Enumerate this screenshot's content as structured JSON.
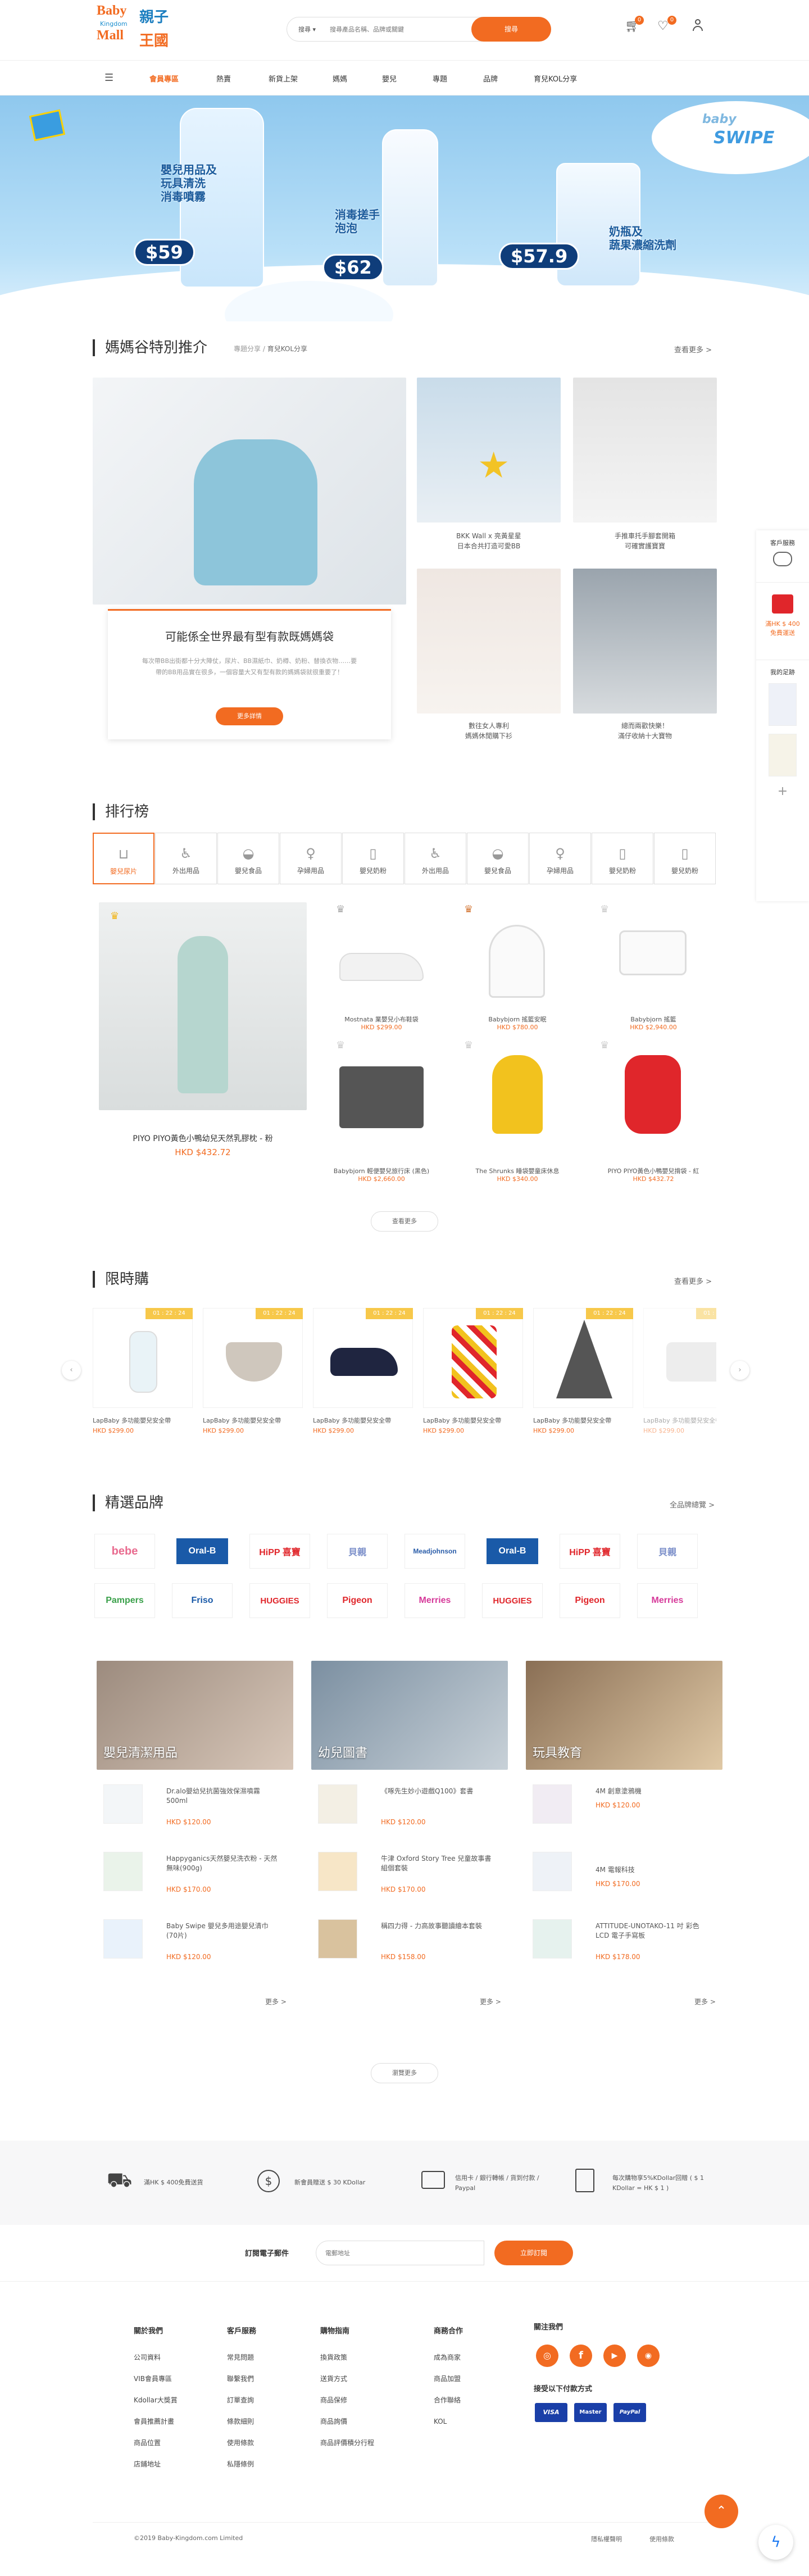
{
  "header": {
    "logo_en_top": "Baby",
    "logo_en_mid": "Kingdom",
    "logo_en_bot": "Mall",
    "logo_zh_top": "親子",
    "logo_zh_bot": "王國",
    "search_category": "搜尋",
    "search_placeholder": "搜尋產品名稱、品牌或關鍵",
    "search_button": "搜尋",
    "cart_count": "0",
    "wish_count": "0"
  },
  "nav": [
    "會員專區",
    "熱賣",
    "新貨上架",
    "媽媽",
    "嬰兒",
    "專題",
    "品牌",
    "育兒KOL分享"
  ],
  "banner": {
    "item1_line1": "嬰兒用品及",
    "item1_line2": "玩具清洗",
    "item1_line3": "消毒噴霧",
    "item1_price": "$59",
    "item2_line1": "消毒搓手",
    "item2_line2": "泡泡",
    "item2_price": "$62",
    "item3_line1": "奶瓶及",
    "item3_line2": "蔬果濃縮洗劑",
    "item3_price": "$57.9",
    "brand_top": "baby",
    "brand_bot": "SWIPE"
  },
  "mom_section": {
    "title": "媽媽谷特別推介",
    "crumb1": "專題分享",
    "crumb2": "育兒KOL分享",
    "more": "查看更多 >",
    "feature_title": "可能係全世界最有型有款既媽媽袋",
    "feature_desc": "每次帶BB出街都十分大陣仗，尿片、BB濕紙巾、奶樽、奶粉、替換衣物……要帶的BB用品實在很多，一個容量大又有型有款的媽媽袋就很重要了！",
    "feature_button": "更多詳情",
    "cards": [
      {
        "title": "BKK Wall x 亮黃星星",
        "subtitle": "日本合共打造可愛BB"
      },
      {
        "title": "手推車托手腳套開箱",
        "subtitle": "可確實護寶寶"
      },
      {
        "title": "數往女人專利",
        "subtitle": "媽媽休閒購下衫"
      },
      {
        "title": "總而兩歡快樂！",
        "subtitle": "滿仔收納十大寶物"
      }
    ]
  },
  "ranking": {
    "title": "排行榜",
    "tabs": [
      "嬰兒尿片",
      "外出用品",
      "嬰兒食品",
      "孕婦用品",
      "嬰兒奶粉",
      "外出用品",
      "嬰兒食品",
      "孕婦用品",
      "嬰兒奶粉",
      "嬰兒奶粉"
    ],
    "top_name": "PIYO PIYO黃色小鴨幼兒天然乳膠枕 - 粉",
    "top_price": "HKD $432.72",
    "items": [
      {
        "name": "Mostnata 業嬰兒小布鞋袋",
        "price": "HKD $299.00"
      },
      {
        "name": "Babybjorn 搖籃安眠",
        "price": "HKD $780.00"
      },
      {
        "name": "Babybjorn 搖籃",
        "price": "HKD $2,940.00"
      },
      {
        "name": "Babybjorn 輕便嬰兒旅行床 (黑色)",
        "price": "HKD $2,660.00"
      },
      {
        "name": "The Shrunks 睡袋嬰童床休息",
        "price": "HKD $340.00"
      },
      {
        "name": "PIYO PIYO黃色小鴨嬰兒揹袋 - 紅",
        "price": "HKD $432.72"
      }
    ],
    "more_button": "查看更多"
  },
  "flash": {
    "title": "限時購",
    "more": "查看更多 >",
    "badge": "01 : 22 : 24",
    "items": [
      {
        "name": "LapBaby 多功能嬰兒安全帶",
        "price": "HKD $299.00"
      },
      {
        "name": "LapBaby 多功能嬰兒安全帶",
        "price": "HKD $299.00"
      },
      {
        "name": "LapBaby 多功能嬰兒安全帶",
        "price": "HKD $299.00"
      },
      {
        "name": "LapBaby 多功能嬰兒安全帶",
        "price": "HKD $299.00"
      },
      {
        "name": "LapBaby 多功能嬰兒安全帶",
        "price": "HKD $299.00"
      },
      {
        "name": "LapBaby 多功能嬰兒安全帶",
        "price": "HKD $299.00"
      }
    ]
  },
  "brands": {
    "title": "精選品牌",
    "more": "全品牌總覽 >",
    "row1": [
      "bebe",
      "Oral-B",
      "HiPP 喜寶",
      "貝親",
      "Meadjohnson",
      "Oral-B",
      "HiPP 喜寶",
      "貝親"
    ],
    "row2": [
      "Pampers",
      "Friso",
      "HUGGIES",
      "Pigeon",
      "Merries",
      "HUGGIES",
      "Pigeon",
      "Merries"
    ]
  },
  "categories": [
    {
      "title": "嬰兒清潔用品",
      "more": "更多 >",
      "items": [
        {
          "name": "Dr.alo嬰幼兒抗菌強效保濕噴霧 500ml",
          "price": "HKD $120.00"
        },
        {
          "name": "Happyganics天然嬰兒洗衣粉 - 天然無味(900g)",
          "price": "HKD $170.00"
        },
        {
          "name": "Baby Swipe 嬰兒多用途嬰兒清巾(70片)",
          "price": "HKD $120.00"
        }
      ]
    },
    {
      "title": "幼兒圖書",
      "more": "更多 >",
      "items": [
        {
          "name": "《啄先生妙小遊戲Q100》套書",
          "price": "HKD $120.00"
        },
        {
          "name": "牛津 Oxford Story Tree 兒童故事書組個套裝",
          "price": "HKD $170.00"
        },
        {
          "name": "稱四力得 - 力高故事聽讀繪本套裝",
          "price": "HKD $158.00"
        }
      ]
    },
    {
      "title": "玩具教育",
      "more": "更多 >",
      "items": [
        {
          "name": "4M 創意塗鴉機",
          "price": "HKD $120.00"
        },
        {
          "name": "4M 電報科技",
          "price": "HKD $170.00"
        },
        {
          "name": "ATTITUDE-UNOTAKO-11 吋 彩色LCD 電子手寫板",
          "price": "HKD $178.00"
        }
      ]
    }
  ],
  "view_more_button": "瀏覽更多",
  "side": {
    "service": "客戶服務",
    "promo1": "滿HK $ 400",
    "promo2": "免費運送",
    "recent": "我的足跡",
    "add": "+"
  },
  "benefits": [
    "滿HK $ 400免費送貨",
    "新會員贈送 $ 30 KDollar",
    "信用卡 / 銀行轉帳 / 貨到付款 / Paypal",
    "每次購物享5%KDollar回贈 ( $ 1 KDollar = HK $ 1 )"
  ],
  "newsletter": {
    "label": "訂閱電子郵件",
    "placeholder": "電郵地址",
    "button": "立即訂閱"
  },
  "footer": {
    "col1_title": "關於我們",
    "col1": [
      "公司資料",
      "VIB會員專區",
      "Kdollar大獎賞",
      "會員推薦計畫",
      "商品位置",
      "店鋪地址"
    ],
    "col2_title": "客戶服務",
    "col2": [
      "常見問題",
      "聯繫我們",
      "訂單查詢",
      "條款細則",
      "使用條款",
      "私隱條例"
    ],
    "col3_title": "購物指南",
    "col3": [
      "換貨政策",
      "送貨方式",
      "商品保修",
      "商品詢價",
      "商品評價積分行程"
    ],
    "col4_title": "商務合作",
    "col4": [
      "成為商家",
      "商品加盟",
      "合作聯絡",
      "KOL"
    ],
    "follow_title": "關注我們",
    "pay_title": "接受以下付款方式",
    "pay": [
      "VISA",
      "Master",
      "PayPal"
    ],
    "copyright": "©2019 Baby-Kingdom.com Limited",
    "links": [
      "隱私權聲明",
      "使用條款"
    ]
  },
  "colors": {
    "accent": "#f26b21",
    "sky": "#aed7f4"
  }
}
